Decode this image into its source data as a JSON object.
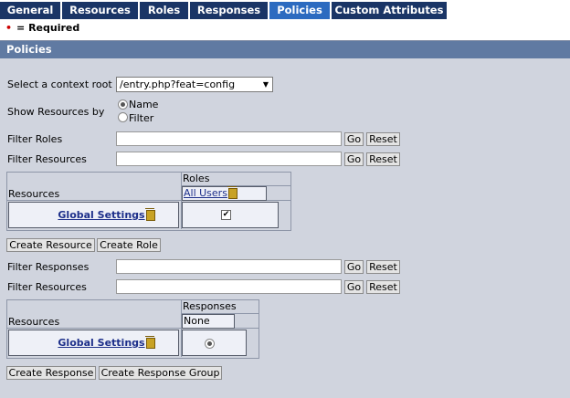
{
  "tabs": [
    {
      "label": "General"
    },
    {
      "label": "Resources"
    },
    {
      "label": "Roles"
    },
    {
      "label": "Responses"
    },
    {
      "label": "Policies"
    },
    {
      "label": "Custom Attributes"
    }
  ],
  "required_note": {
    "marker": "•",
    "text": "= Required"
  },
  "panel": {
    "title": "Policies"
  },
  "context_root": {
    "label": "Select a context root",
    "value": "/entry.php?feat=config"
  },
  "show_resources_by": {
    "label": "Show Resources by",
    "options": [
      "Name",
      "Filter"
    ],
    "selected": "Name"
  },
  "filters": {
    "roles": {
      "label": "Filter Roles",
      "go": "Go",
      "reset": "Reset"
    },
    "resources1": {
      "label": "Filter Resources",
      "go": "Go",
      "reset": "Reset"
    },
    "responses": {
      "label": "Filter Responses",
      "go": "Go",
      "reset": "Reset"
    },
    "resources2": {
      "label": "Filter Resources",
      "go": "Go",
      "reset": "Reset"
    }
  },
  "roles_table": {
    "header_col": "Roles",
    "header_row": "Resources",
    "role": "All Users",
    "resource": "Global Settings",
    "checked": true
  },
  "role_buttons": {
    "create_resource": "Create Resource",
    "create_role": "Create Role"
  },
  "responses_table": {
    "header_col": "Responses",
    "header_row": "Resources",
    "response": "None",
    "resource": "Global Settings",
    "selected": true
  },
  "response_buttons": {
    "create_response": "Create Response",
    "create_response_group": "Create Response Group"
  }
}
